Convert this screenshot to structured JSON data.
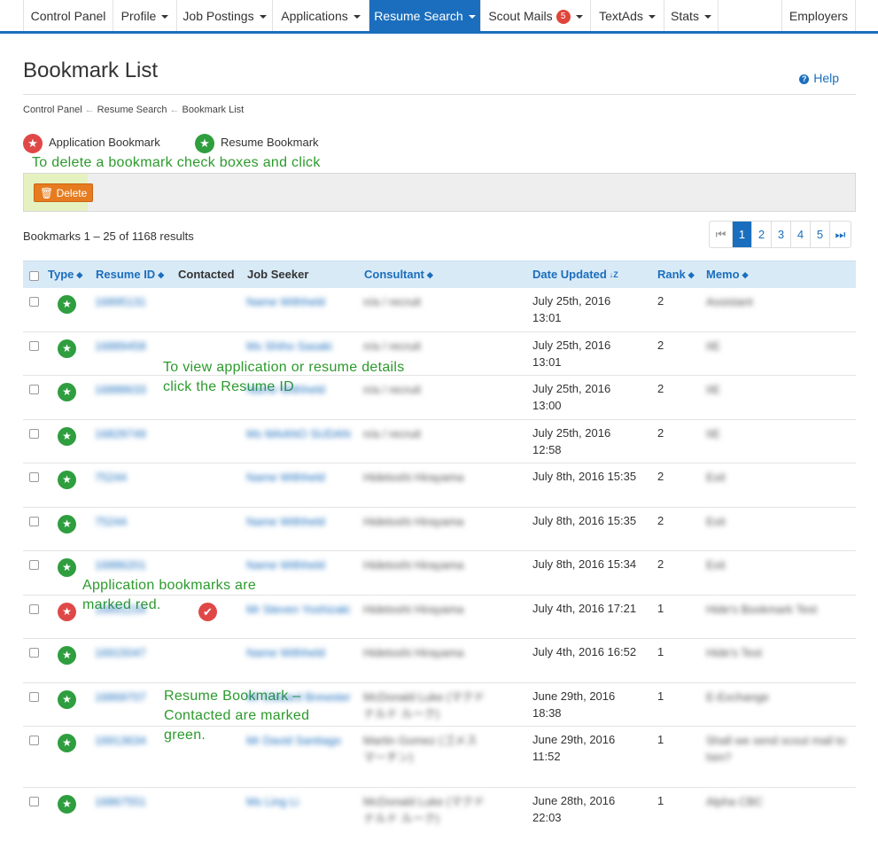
{
  "nav": {
    "items": [
      {
        "label": "Control Panel",
        "caret": false
      },
      {
        "label": "Profile",
        "caret": true
      },
      {
        "label": "Job Postings",
        "caret": true
      },
      {
        "label": "Applications",
        "caret": true
      },
      {
        "label": "Resume Search",
        "caret": true,
        "active": true
      },
      {
        "label": "Scout Mails",
        "caret": true,
        "badge": "5"
      },
      {
        "label": "TextAds",
        "caret": true
      },
      {
        "label": "Stats",
        "caret": true
      },
      {
        "label": "Employers",
        "caret": false
      }
    ]
  },
  "page": {
    "title": "Bookmark List",
    "help": "Help"
  },
  "breadcrumb": [
    "Control Panel",
    "Resume Search",
    "Bookmark List"
  ],
  "legend": {
    "application": "Application Bookmark",
    "resume": "Resume Bookmark"
  },
  "annotations": {
    "delete_hint": "To delete a bookmark check boxes and click",
    "view_hint": "To view application or resume details click the Resume ID",
    "application_hint": "Application bookmarks are marked red.",
    "resume_hint": "Resume Bookmark – Contacted are marked green."
  },
  "toolbar": {
    "delete_label": "Delete"
  },
  "results_text": "Bookmarks 1 – 25 of 1168 results",
  "pagination": {
    "pages": [
      "1",
      "2",
      "3",
      "4",
      "5"
    ],
    "current": "1"
  },
  "table": {
    "headers": {
      "type": "Type",
      "resume_id": "Resume ID",
      "contacted": "Contacted",
      "job_seeker": "Job Seeker",
      "consultant": "Consultant",
      "date_updated": "Date Updated",
      "rank": "Rank",
      "memo": "Memo"
    },
    "rows": [
      {
        "type": "resume",
        "resume_id": "16895131",
        "job_seeker": "Name Withheld",
        "consultant": "n/a / recruit",
        "date1": "July 25th, 2016",
        "date2": "13:01",
        "rank": "2",
        "memo": "Assistant"
      },
      {
        "type": "resume",
        "resume_id": "16889458",
        "job_seeker": "Ms Shiho Sasaki",
        "consultant": "n/a / recruit",
        "date1": "July 25th, 2016",
        "date2": "13:01",
        "rank": "2",
        "memo": "IIE"
      },
      {
        "type": "resume",
        "resume_id": "16888633",
        "job_seeker": "Name Withheld",
        "consultant": "n/a / recruit",
        "date1": "July 25th, 2016",
        "date2": "13:00",
        "rank": "2",
        "memo": "IIE"
      },
      {
        "type": "resume",
        "resume_id": "16829749",
        "job_seeker": "Ms MAANO SUDAN",
        "consultant": "n/a / recruit",
        "date1": "July 25th, 2016",
        "date2": "12:58",
        "rank": "2",
        "memo": "IIE"
      },
      {
        "type": "resume",
        "resume_id": "75244",
        "job_seeker": "Name Withheld",
        "consultant": "Hidetoshi Hirayama",
        "date1": "July 8th, 2016 15:35",
        "date2": "",
        "rank": "2",
        "memo": "Exit"
      },
      {
        "type": "resume",
        "resume_id": "75244",
        "job_seeker": "Name Withheld",
        "consultant": "Hidetoshi Hirayama",
        "date1": "July 8th, 2016 15:35",
        "date2": "",
        "rank": "2",
        "memo": "Exit"
      },
      {
        "type": "resume",
        "resume_id": "16886201",
        "job_seeker": "Name Withheld",
        "consultant": "Hidetoshi Hirayama",
        "date1": "July 8th, 2016 15:34",
        "date2": "",
        "rank": "2",
        "memo": "Exit"
      },
      {
        "type": "application",
        "resume_id": "16891234",
        "job_seeker": "Mr Steven Yoshizaki",
        "consultant": "Hidetoshi Hirayama",
        "date1": "July 4th, 2016 17:21",
        "date2": "",
        "rank": "1",
        "memo": "Hide's Bookmark Test"
      },
      {
        "type": "resume",
        "resume_id": "16915047",
        "job_seeker": "Name Withheld",
        "consultant": "Hidetoshi Hirayama",
        "date1": "July 4th, 2016 16:52",
        "date2": "",
        "rank": "1",
        "memo": "Hide's Test"
      },
      {
        "type": "resume",
        "resume_id": "16869707",
        "job_seeker": "Mr Edward Brewster",
        "consultant": "McDonald Luke (マクドナルド ルーク)",
        "date1": "June 29th, 2016",
        "date2": "18:38",
        "rank": "1",
        "memo": "E-Exchange"
      },
      {
        "type": "resume",
        "resume_id": "16913634",
        "job_seeker": "Mr David Santiago",
        "consultant": "Martin Gomez (ゴメス マーチン)",
        "date1": "June 29th, 2016",
        "date2": "11:52",
        "rank": "1",
        "memo": "Shall we send scout mail to him?"
      },
      {
        "type": "resume",
        "resume_id": "16867551",
        "job_seeker": "Ms Ling Li",
        "consultant": "McDonald Luke (マクドナルド ルーク)",
        "date1": "June 28th, 2016",
        "date2": "22:03",
        "rank": "1",
        "memo": "Alpha CBC"
      }
    ]
  }
}
